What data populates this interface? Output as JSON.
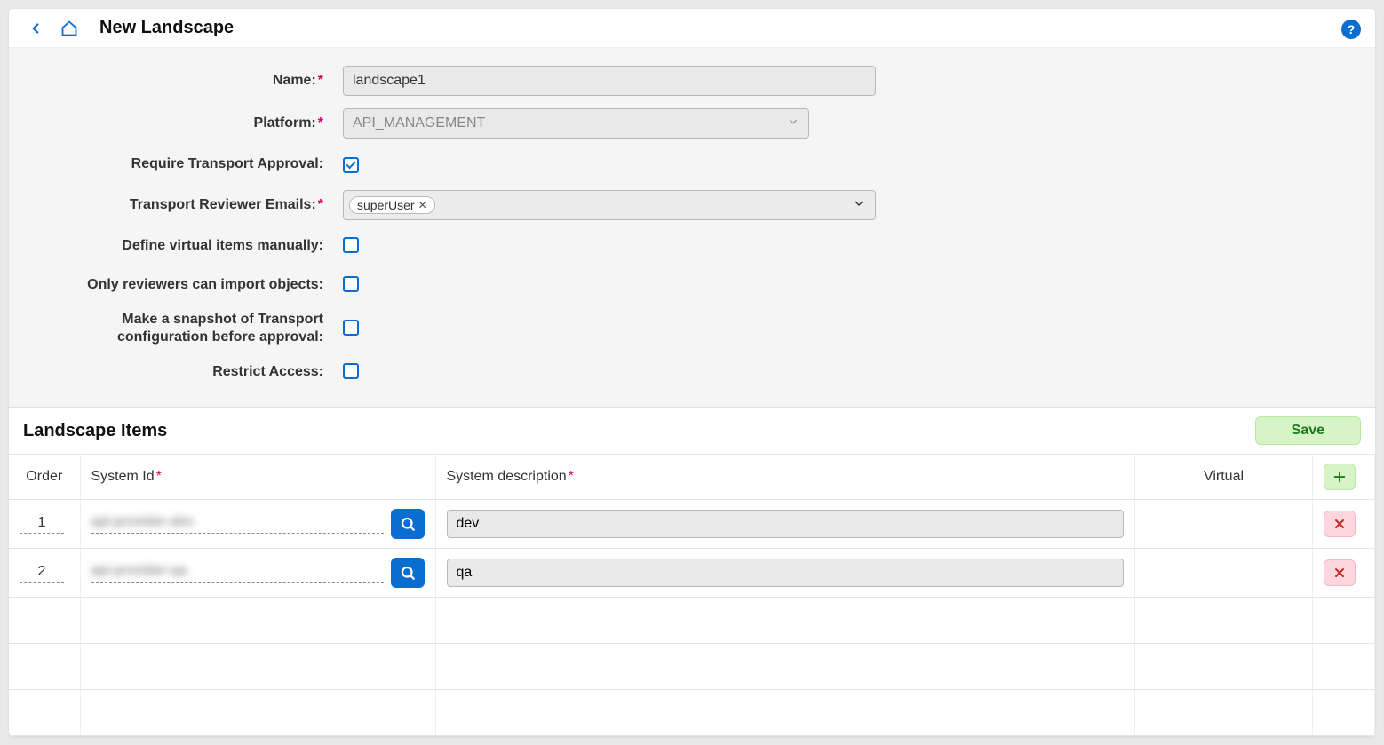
{
  "header": {
    "title": "New Landscape"
  },
  "form": {
    "labels": {
      "name": "Name:",
      "platform": "Platform:",
      "require_approval": "Require Transport Approval:",
      "reviewer_emails": "Transport Reviewer Emails:",
      "define_virtual": "Define virtual items manually:",
      "only_reviewers": "Only reviewers can import objects:",
      "snapshot": "Make a snapshot of Transport configuration before approval:",
      "restrict_access": "Restrict Access:"
    },
    "values": {
      "name": "landscape1",
      "platform": "API_MANAGEMENT",
      "require_approval_checked": true,
      "reviewer_tag": "superUser",
      "define_virtual_checked": false,
      "only_reviewers_checked": false,
      "snapshot_checked": false,
      "restrict_access_checked": false
    }
  },
  "section": {
    "title": "Landscape Items",
    "save_label": "Save"
  },
  "table": {
    "headers": {
      "order": "Order",
      "system_id": "System Id",
      "system_desc": "System description",
      "virtual": "Virtual"
    },
    "rows": [
      {
        "order": "1",
        "system_id": "api-provider-dev",
        "description": "dev"
      },
      {
        "order": "2",
        "system_id": "api-provider-qa",
        "description": "qa"
      }
    ]
  }
}
